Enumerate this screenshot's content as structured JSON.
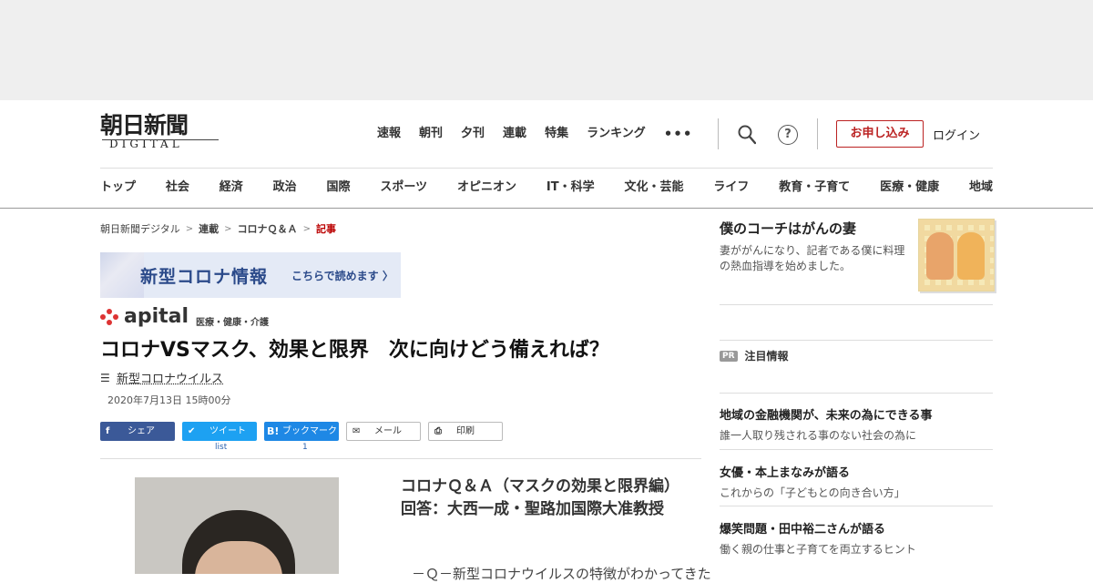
{
  "header": {
    "logo_kanji": "朝日新聞",
    "logo_sub": "DIGITAL",
    "top_nav": [
      "速報",
      "朝刊",
      "夕刊",
      "連載",
      "特集",
      "ランキング"
    ],
    "more": "•••",
    "help_glyph": "?",
    "apply_label": "お申し込み",
    "login_label": "ログイン",
    "categories": [
      "トップ",
      "社会",
      "経済",
      "政治",
      "国際",
      "スポーツ",
      "オピニオン",
      "IT・科学",
      "文化・芸能",
      "ライフ",
      "教育・子育て",
      "医療・健康",
      "地域"
    ]
  },
  "breadcrumb": {
    "items": [
      "朝日新聞デジタル",
      "連載",
      "コロナＱ＆Ａ",
      "記事"
    ],
    "separator": ">"
  },
  "banner": {
    "title": "新型コロナ情報",
    "cta": "こちらで読めます 〉"
  },
  "apital": {
    "word": "apital",
    "section": "医療・健康・介護"
  },
  "article": {
    "headline": "コロナVSマスク、効果と限界　次に向けどう備えれば？",
    "tag": "新型コロナウイルス",
    "date": "2020年7月13日 15時00分",
    "subhead": "コロナＱ＆Ａ（マスクの効果と限界編）　回答：大西一成・聖路加国際大准教授",
    "body_start": "－Ｑ－新型コロナウイルスの特徴がわかってきた"
  },
  "share": {
    "facebook": {
      "icon": "f",
      "label": "シェア"
    },
    "twitter": {
      "icon": "✔",
      "label": "ツイート"
    },
    "hatena": {
      "icon": "B!",
      "label": "ブックマーク"
    },
    "mail": {
      "icon": "✉",
      "label": "メール"
    },
    "print": {
      "icon": "⎙",
      "label": "印刷"
    },
    "twitter_count": "list",
    "hatena_count": "1"
  },
  "sidebar": {
    "feature_title": "僕のコーチはがんの妻",
    "feature_desc": "妻ががんになり、記者である僕に料理の熱血指導を始めました。",
    "pr_badge": "PR",
    "pr_title": "注目情報",
    "items": [
      {
        "headline": "地域の金融機関が、未来の為にできる事",
        "sub": "誰一人取り残される事のない社会の為に"
      },
      {
        "headline": "女優・本上まなみが語る",
        "sub": "これからの「子どもとの向き合い方」"
      },
      {
        "headline": "爆笑問題・田中裕二さんが語る",
        "sub": "働く親の仕事と子育てを両立するヒント"
      }
    ]
  }
}
